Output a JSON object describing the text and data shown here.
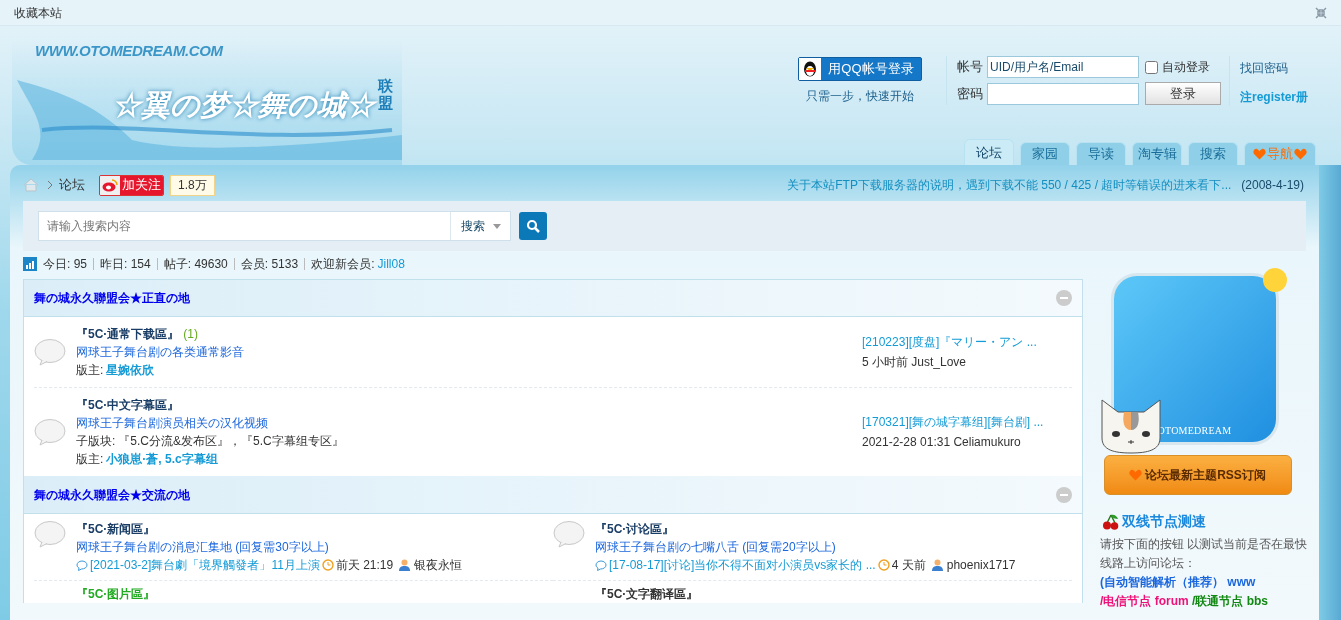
{
  "top_bar": {
    "bookmark": "收藏本站"
  },
  "logo": {
    "url": "WWW.OTOMEDREAM.COM",
    "title": "☆翼の梦☆舞の城☆",
    "suffix": "联盟"
  },
  "login": {
    "qq_button": "用QQ帐号登录",
    "qq_hint": "只需一步，快速开始",
    "account_label": "帐号",
    "account_value": "UID/用户名/Email",
    "auto_login": {
      "label": "自动登录",
      "checked": false
    },
    "password_label": "密码",
    "submit": "登录",
    "forgot": "找回密码",
    "register": "注register册"
  },
  "tabs": [
    {
      "label": "论坛",
      "selected": true,
      "kind": "plain"
    },
    {
      "label": "家园",
      "selected": false,
      "kind": "plain"
    },
    {
      "label": "导读",
      "selected": false,
      "kind": "plain"
    },
    {
      "label": "淘专辑",
      "selected": false,
      "kind": "plain"
    },
    {
      "label": "搜索",
      "selected": false,
      "kind": "plain"
    },
    {
      "label": "导航",
      "selected": false,
      "kind": "hearts"
    }
  ],
  "breadcrumb": {
    "current": "论坛",
    "follow_button": "加关注",
    "follow_count": "1.8万"
  },
  "announcement": {
    "text": "关于本站FTP下载服务器的说明，遇到下载不能 550 / 425  / 超时等错误的进来看下...",
    "date": "(2008-4-19)"
  },
  "search": {
    "placeholder": "请输入搜索内容",
    "scope": "搜索"
  },
  "stats": [
    {
      "text": "今日: 95"
    },
    {
      "text": "昨日: 154"
    },
    {
      "text": "帖子: 49630"
    },
    {
      "text": "会员: 5133"
    },
    {
      "text": "欢迎新会员:",
      "link": "Jill08"
    }
  ],
  "sections": [
    {
      "title": "舞の城永久聯盟会★正直の地",
      "kind": "list",
      "forums": [
        {
          "name": "『5C·通常下载區』",
          "count": "(1)",
          "description": "网球王子舞台剧の各类通常影音",
          "moderator_label": "版主:",
          "moderators": "星婉依欣",
          "last_title": "[210223][度盘]『マリー・アン ...",
          "last_info": "5 小时前 Just_Love"
        },
        {
          "name": "『5C·中文字幕區』",
          "description": "网球王子舞台剧演员相关の汉化视频",
          "sub_label": "子版块:",
          "sub_separator": "，",
          "subforums": [
            "『5.C分流&发布区』",
            "『5.C字幕组专区』"
          ],
          "moderator_label": "版主:",
          "moderators": "小狼崽·蒼, 5.c字幕组",
          "last_title": "[170321][舞の城字幕组][舞台剧] ...",
          "last_info": "2021-2-28 01:31 Celiamukuro"
        }
      ]
    },
    {
      "title": "舞の城永久聯盟会★交流の地",
      "kind": "grid",
      "forums": [
        {
          "name": "『5C·新闻區』",
          "description": "网球王子舞台剧の消息汇集地 (回复需30字以上)",
          "last_title": "[2021-03-2]舞台劇「境界觸發者」11月上演",
          "last_time": "前天 21:19",
          "last_user": "银夜永恒"
        },
        {
          "name": "『5C·讨论區』",
          "description": "网球王子舞台剧の七嘴八舌 (回复需20字以上)",
          "last_title": "[17-08-17][讨论]当你不得不面对小演员vs家长的 ...",
          "last_time": "4 天前",
          "last_user": "phoenix1717"
        },
        {
          "name": "『5C·图片區』",
          "color": "#22aa22"
        },
        {
          "name": "『5C·文字翻译區』",
          "color": "#333333"
        }
      ]
    }
  ],
  "sidebar": {
    "badge_brand": "OTOMEDREAM",
    "rss_button": "论坛最新主题RSS订阅",
    "speed_title": "双线节点测速",
    "speed_text": "请按下面的按钮 以测试当前是否在最快线路上访问论坛： ",
    "node_links": [
      {
        "text": "(自动智能解析（推荐） www",
        "color": "#1a66dd"
      },
      {
        "text": "/电信节点 forum",
        "color": "#ee1177"
      },
      {
        "text": "/联通节点 bbs",
        "color": "#118811"
      }
    ]
  }
}
